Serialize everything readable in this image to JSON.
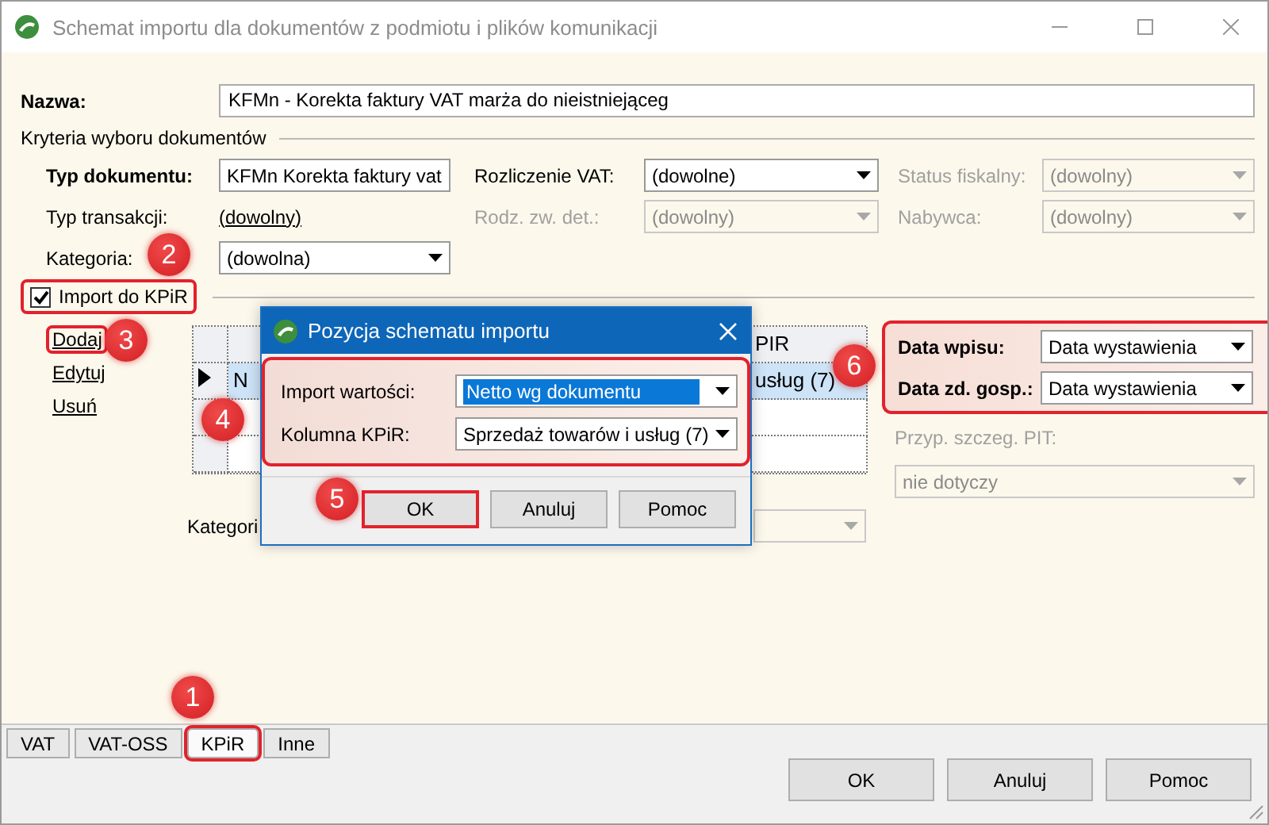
{
  "window": {
    "title": "Schemat importu dla dokumentów z podmiotu i plików komunikacji"
  },
  "name_field": {
    "label": "Nazwa:",
    "value": "KFMn - Korekta faktury VAT marża do nieistniejąceg"
  },
  "criteria": {
    "title": "Kryteria wyboru dokumentów",
    "fields": [
      {
        "label": "Typ dokumentu:",
        "kind": "select",
        "value": "KFMn Korekta faktury vat",
        "bold": true,
        "disabled": false
      },
      {
        "label": "Rozliczenie VAT:",
        "kind": "select",
        "value": "(dowolne)",
        "bold": false,
        "disabled": false
      },
      {
        "label": "Status fiskalny:",
        "kind": "select",
        "value": "(dowolny)",
        "bold": false,
        "disabled": true
      },
      {
        "label": "Typ transakcji:",
        "kind": "link",
        "value": "(dowolny)",
        "bold": false,
        "disabled": false
      },
      {
        "label": "Rodz. zw. det.:",
        "kind": "select",
        "value": "(dowolny)",
        "bold": false,
        "disabled": true
      },
      {
        "label": "Nabywca:",
        "kind": "select",
        "value": "(dowolny)",
        "bold": false,
        "disabled": true
      },
      {
        "label": "Kategoria:",
        "kind": "select",
        "value": "(dowolna)",
        "bold": false,
        "disabled": false
      }
    ]
  },
  "import_checkbox": {
    "label": "Import do KPiR",
    "checked": true,
    "highlighted": true
  },
  "actions": [
    {
      "label": "Dodaj",
      "highlighted": true
    },
    {
      "label": "Edytuj",
      "highlighted": false
    },
    {
      "label": "Usuń",
      "highlighted": false
    }
  ],
  "table": {
    "column_2_header": "PIR",
    "rows": [
      {
        "cells": [
          "N",
          "usług (7)"
        ],
        "selected": true
      }
    ]
  },
  "category_row": {
    "label": "Kategori",
    "disabled": true
  },
  "dates": {
    "highlighted": true,
    "fields": [
      {
        "label": "Data wpisu:",
        "value": "Data wystawienia"
      },
      {
        "label": "Data zd. gosp.:",
        "value": "Data wystawienia"
      }
    ]
  },
  "pit": {
    "label": "Przyp. szczeg. PIT:",
    "value": "nie dotyczy",
    "disabled": true
  },
  "dialog": {
    "title": "Pozycja schematu importu",
    "highlighted": true,
    "fields": [
      {
        "label": "Import wartości:",
        "value": "Netto wg dokumentu",
        "focused": true
      },
      {
        "label": "Kolumna KPiR:",
        "value": "Sprzedaż towarów i usług (7)",
        "focused": false
      }
    ],
    "buttons": [
      {
        "label": "OK",
        "highlighted": true
      },
      {
        "label": "Anuluj",
        "highlighted": false
      },
      {
        "label": "Pomoc",
        "highlighted": false
      }
    ]
  },
  "tabs": [
    {
      "label": "VAT",
      "selected": false,
      "highlighted": false
    },
    {
      "label": "VAT-OSS",
      "selected": false,
      "highlighted": false
    },
    {
      "label": "KPiR",
      "selected": true,
      "highlighted": true
    },
    {
      "label": "Inne",
      "selected": false,
      "highlighted": false
    }
  ],
  "buttons": [
    "OK",
    "Anuluj",
    "Pomoc"
  ],
  "annotations": [
    {
      "number": "1"
    },
    {
      "number": "2"
    },
    {
      "number": "3"
    },
    {
      "number": "4"
    },
    {
      "number": "5"
    },
    {
      "number": "6"
    }
  ]
}
